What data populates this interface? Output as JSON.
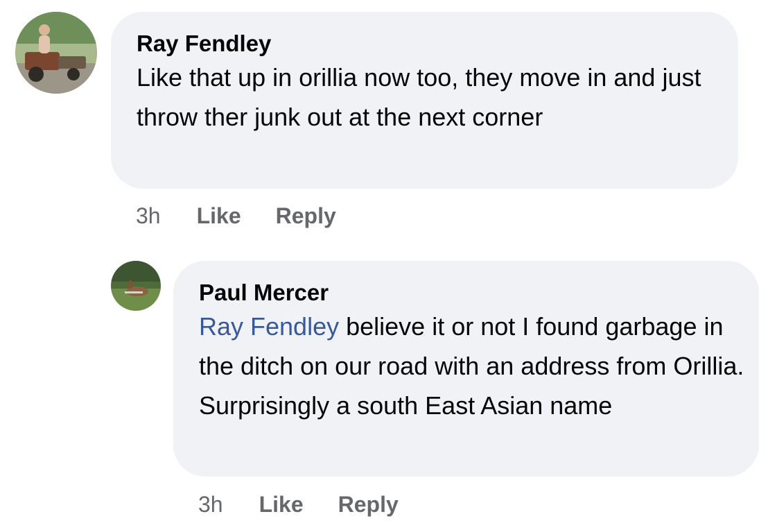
{
  "comments": [
    {
      "author": "Ray Fendley",
      "text": "Like that up in orillia now  too, they move in and  just throw ther junk out at the next corner",
      "time": "3h",
      "like_label": "Like",
      "reply_label": "Reply",
      "avatar_icon": "user-avatar-photo"
    }
  ],
  "replies": [
    {
      "author": "Paul Mercer",
      "mention": "Ray Fendley",
      "text_line1": " believe it or not I found garbage in the ditch on our road with an address from Orillia.",
      "text_line2": "Surprisingly a south East Asian name",
      "time": "3h",
      "like_label": "Like",
      "reply_label": "Reply",
      "avatar_icon": "user-avatar-photo"
    }
  ],
  "colors": {
    "bubble_background": "#f0f2f5",
    "mention": "#385898",
    "meta_text": "#65676b",
    "body_text": "#050505"
  }
}
